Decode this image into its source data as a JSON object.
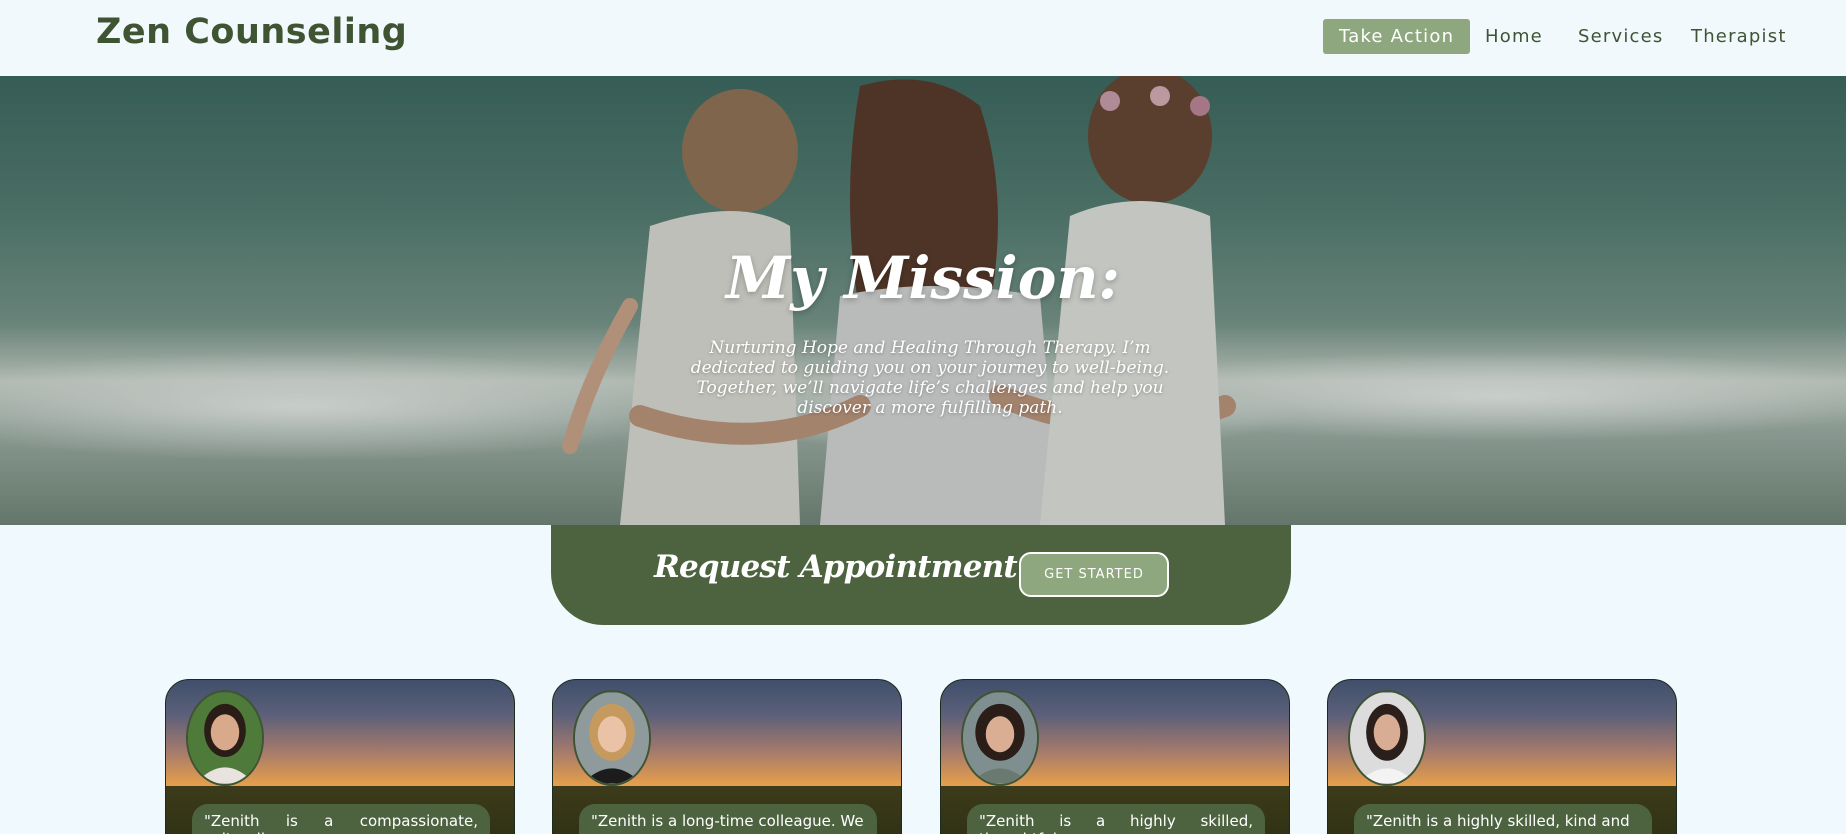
{
  "header": {
    "brand": "Zen Counseling",
    "nav": [
      {
        "label": "Take Action",
        "cta": true
      },
      {
        "label": "Home"
      },
      {
        "label": "Services"
      },
      {
        "label": "Therapist"
      }
    ]
  },
  "hero": {
    "title": "My Mission:",
    "text": "Nurturing Hope and Healing Through Therapy. I’m dedicated to guiding you on your journey to well-being. Together, we’ll navigate life’s challenges and help you discover a more fulfilling path."
  },
  "appointment": {
    "title": "Request Appointment today",
    "button": "GET STARTED"
  },
  "testimonials": [
    {
      "quote": "\"Zenith is a compassionate, culturally"
    },
    {
      "quote": "\"Zenith is a long-time colleague. We"
    },
    {
      "quote": "\"Zenith is a highly skilled, thoughtful,"
    },
    {
      "quote": "\"Zenith is a highly skilled, kind and"
    }
  ],
  "colors": {
    "background": "#f0f9fd",
    "brand_green": "#3e5433",
    "accent_green": "#8fa77f",
    "band_green": "#4d6340"
  }
}
